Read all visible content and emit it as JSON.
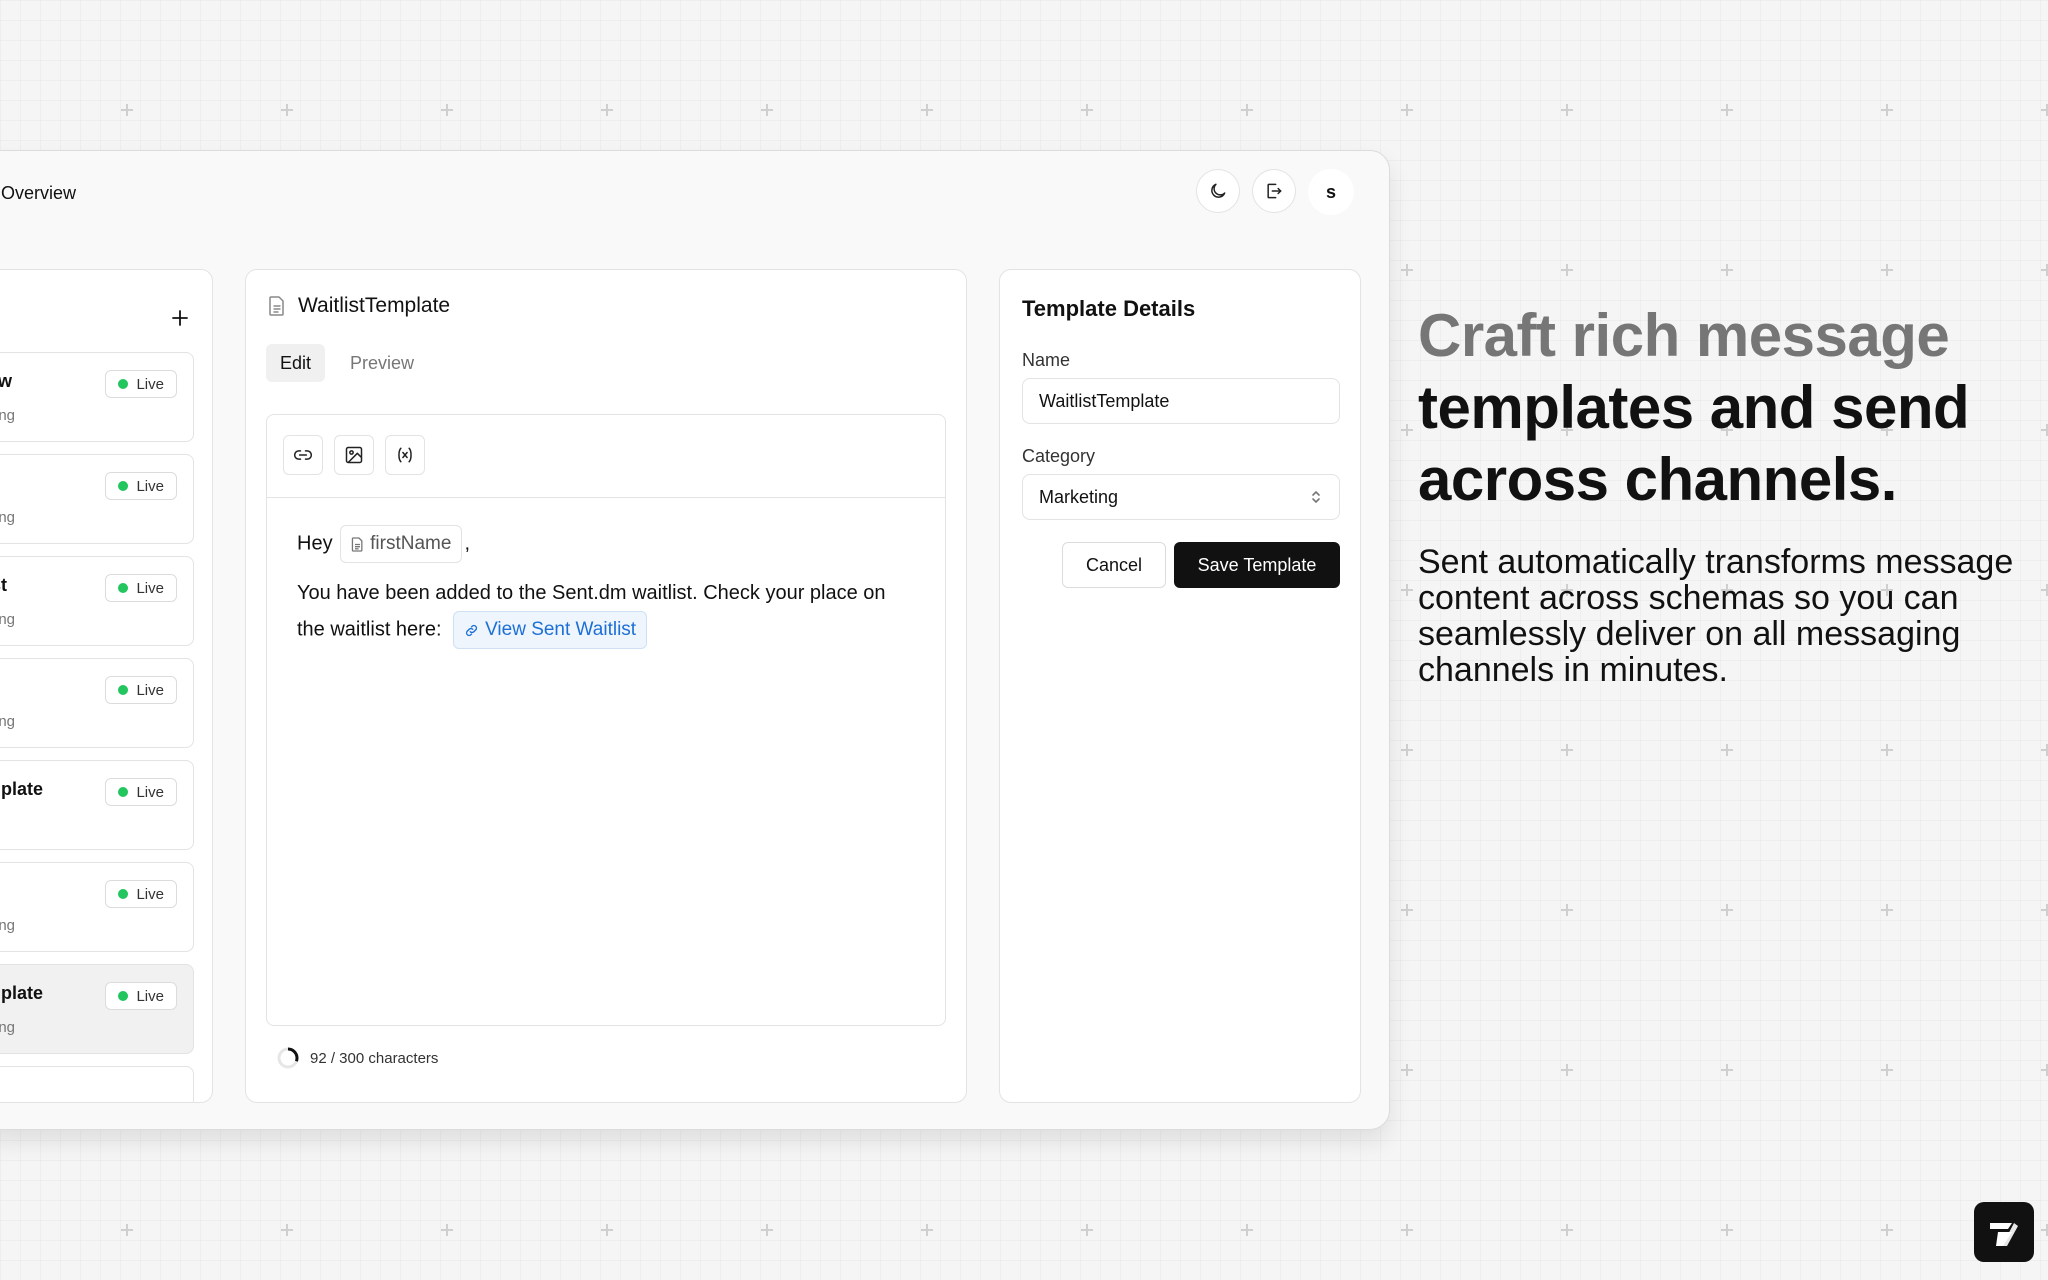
{
  "header": {
    "title": "Overview",
    "avatar_initial": "s"
  },
  "template_list": {
    "items": [
      {
        "name": "New",
        "category": "keting",
        "status": "Live",
        "active": false
      },
      {
        "name": "",
        "category": "keting",
        "status": "Live",
        "active": false
      },
      {
        "name": "test",
        "category": "keting",
        "status": "Live",
        "active": false
      },
      {
        "name": "",
        "category": "keting",
        "status": "Live",
        "active": false
      },
      {
        "name": "emplate",
        "category": "/",
        "status": "Live",
        "active": false
      },
      {
        "name": "",
        "category": "keting",
        "status": "Live",
        "active": false
      },
      {
        "name": "emplate",
        "category": "keting",
        "status": "Live",
        "active": true
      }
    ]
  },
  "editor": {
    "title": "WaitlistTemplate",
    "tabs": [
      "Edit",
      "Preview"
    ],
    "message": {
      "greeting": "Hey",
      "variable": "firstName",
      "comma": ",",
      "body": "You have been added to the Sent.dm waitlist. Check your place on the waitlist here:",
      "link_text": "View Sent Waitlist"
    },
    "char_count": "92 / 300 characters",
    "char_fraction": 0.3067
  },
  "details": {
    "title": "Template Details",
    "name_label": "Name",
    "name_value": "WaitlistTemplate",
    "category_label": "Category",
    "category_value": "Marketing",
    "cancel_label": "Cancel",
    "save_label": "Save Template"
  },
  "hero": {
    "line1": "Craft rich message",
    "line2": "templates and send",
    "line3": "across channels.",
    "subtitle": "Sent automatically transforms message content across schemas so you can seamlessly deliver on all messaging channels in minutes."
  },
  "colors": {
    "accent_dark": "#111111",
    "status_live": "#22c55e",
    "link": "#1d6fd6",
    "muted_heading": "#767676"
  },
  "icons": [
    "moon-icon",
    "logout-icon",
    "plus-icon",
    "file-icon",
    "link-icon",
    "image-icon",
    "variable-icon",
    "chevrons-updown-icon",
    "sent-logo"
  ]
}
